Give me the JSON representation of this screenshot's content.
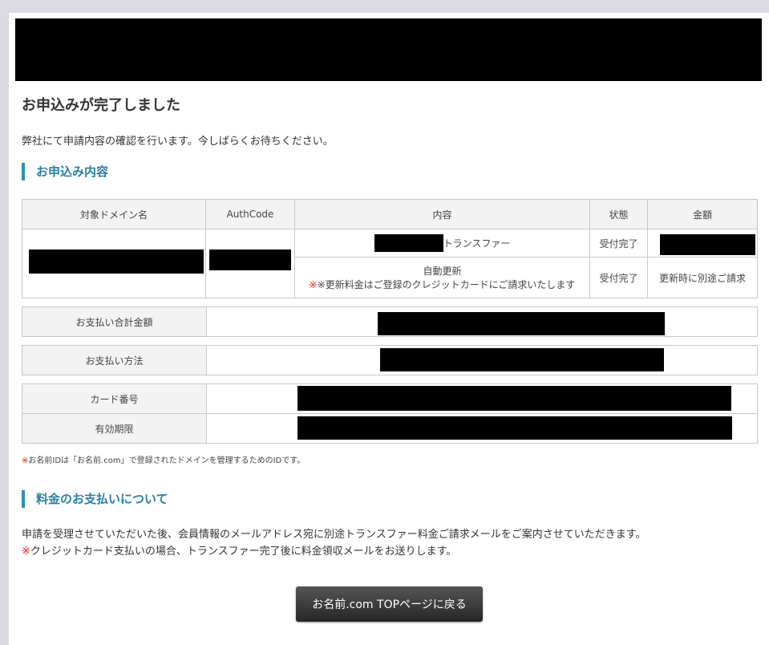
{
  "page": {
    "title": "お申込みが完了しました",
    "intro": "弊社にて申請内容の確認を行います。今しばらくお待ちください。"
  },
  "application": {
    "heading": "お申込み内容",
    "columns": [
      "対象ドメイン名",
      "AuthCode",
      "内容",
      "状態",
      "金額"
    ],
    "rows": [
      {
        "content": "トランスファー",
        "status": "受付完了"
      },
      {
        "content": "自動更新",
        "content_note": "※更新料金はご登録のクレジットカードにご請求いたします",
        "status": "受付完了",
        "amount": "更新時に別途ご請求"
      }
    ]
  },
  "payment": {
    "total_label": "お支払い合計金額",
    "method_label": "お支払い方法",
    "card_number_label": "カード番号",
    "expiry_label": "有効期限"
  },
  "note": {
    "mark": "※",
    "text": "お名前IDは「お名前.com」で登録されたドメインを管理するためのIDです。"
  },
  "fee_section": {
    "heading": "料金のお支払いについて",
    "line1": "申請を受理させていただいた後、会員情報のメールアドレス宛に別途トランスファー料金ご請求メールをご案内させていただきます。",
    "line2_mark": "※",
    "line2": "クレジットカード支払いの場合、トランスファー完了後に料金領収メールをお送りします。"
  },
  "button": {
    "label": "お名前.com TOPページに戻る"
  },
  "colors": {
    "accent": "#2a8fb8",
    "warning": "#e02020"
  }
}
